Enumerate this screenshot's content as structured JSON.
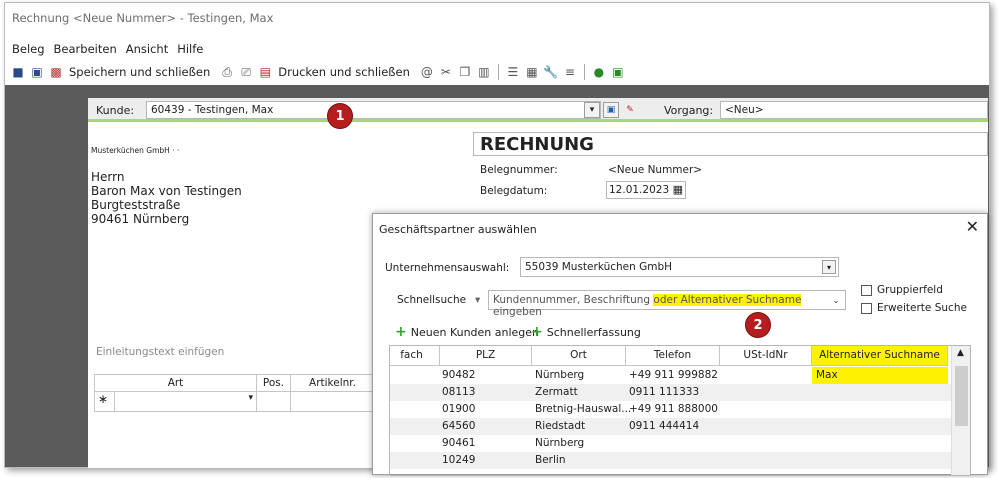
{
  "window": {
    "title": "Rechnung <Neue Nummer> - Testingen, Max"
  },
  "menu": [
    "Beleg",
    "Bearbeiten",
    "Ansicht",
    "Hilfe"
  ],
  "toolbar": {
    "save_close": "Speichern und schließen",
    "print_close": "Drucken und schließen"
  },
  "kunde": {
    "label": "Kunde:",
    "value": "60439 - Testingen, Max",
    "vorgang_label": "Vorgang:",
    "vorgang_value": "<Neu>"
  },
  "badges": [
    "1",
    "2"
  ],
  "address": {
    "sender": "Musterküchen GmbH · ·",
    "lines": [
      "Herrn",
      "Baron Max von Testingen",
      "Burgteststraße",
      "90461 Nürnberg"
    ]
  },
  "invoice": {
    "title": "RECHNUNG",
    "number_label": "Belegnummer:",
    "number_value": "<Neue Nummer>",
    "date_label": "Belegdatum:",
    "date_value": "12.01.2023"
  },
  "einleitung": "Einleitungstext einfügen",
  "grid": {
    "headers": [
      "Art",
      "Pos.",
      "Artikelnr."
    ],
    "new_row_marker": "∗"
  },
  "dialog": {
    "title": "Geschäftspartner auswählen",
    "company_label": "Unternehmensauswahl:",
    "company_value": "55039 Musterküchen GmbH",
    "quick_label": "Schnellsuche",
    "quick_placeholder_a": "Kundennummer, Beschriftung ",
    "quick_placeholder_hl": "oder Alternativer Suchname",
    "quick_placeholder_b": " eingeben",
    "chk_group": "Gruppierfeld",
    "chk_extended": "Erweiterte Suche",
    "action_new": "Neuen Kunden anlegen",
    "action_quick": "Schnellerfassung",
    "columns": [
      "fach",
      "PLZ",
      "Ort",
      "Telefon",
      "USt-IdNr",
      "Alternativer Suchname"
    ],
    "rows": [
      {
        "plz": "90482",
        "ort": "Nürnberg",
        "tel": "+49 911 999882",
        "alt": "Max"
      },
      {
        "plz": "08113",
        "ort": "Zermatt",
        "tel": "0911 111333",
        "alt": ""
      },
      {
        "plz": "01900",
        "ort": "Bretnig-Hauswal...",
        "tel": "+49 911 888000",
        "alt": ""
      },
      {
        "plz": "64560",
        "ort": "Riedstadt",
        "tel": "0911 444414",
        "alt": ""
      },
      {
        "plz": "90461",
        "ort": "Nürnberg",
        "tel": "",
        "alt": ""
      },
      {
        "plz": "10249",
        "ort": "Berlin",
        "tel": "",
        "alt": ""
      }
    ]
  },
  "colors": {
    "highlight": "#fff200",
    "badge": "#b41e1e",
    "accent_green": "#a6d87a"
  }
}
